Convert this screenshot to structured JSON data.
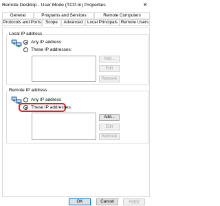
{
  "window": {
    "title": "Remote Desktop - User Mode (TCP-In) Properties",
    "close_glyph": "×"
  },
  "tabs": {
    "row1": [
      "General",
      "Programs and Services",
      "Remote Computers"
    ],
    "row2": [
      "Protocols and Ports",
      "Scope",
      "Advanced",
      "Local Principals",
      "Remote Users"
    ],
    "active": "Scope"
  },
  "local_ip": {
    "label": "Local IP address",
    "any_ip": "Any IP address",
    "these_ip": "These IP addresses:",
    "selected": "any",
    "add": "Add...",
    "edit": "Edit",
    "remove": "Remove"
  },
  "remote_ip": {
    "label": "Remote IP address",
    "any_ip": "Any IP address",
    "these_ip": "These IP addresses:",
    "selected": "these",
    "add": "Add...",
    "edit": "Edit",
    "remove": "Remove"
  },
  "buttons": {
    "ok": "OK",
    "cancel": "Cancel",
    "apply": "Apply"
  },
  "colors": {
    "highlight": "#e31b23",
    "default_button_border": "#0078d7"
  }
}
